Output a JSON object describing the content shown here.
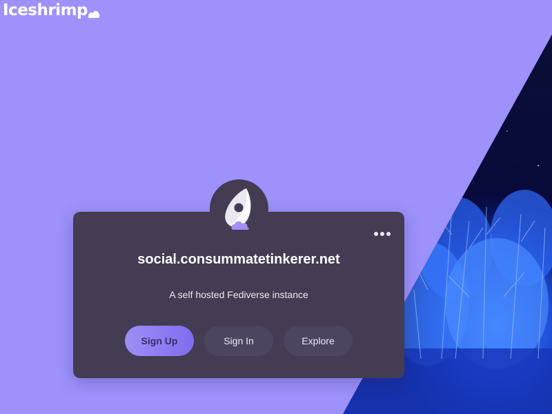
{
  "brand": {
    "name": "Iceshrimp",
    "icon": "cloud-icon"
  },
  "instance": {
    "name": "social.consummatetinkerer.net",
    "description": "A self hosted Fediverse instance",
    "avatar_icon": "iceshrimp-logo-icon"
  },
  "menu": {
    "icon": "more-dots-icon"
  },
  "actions": {
    "signup_label": "Sign Up",
    "signin_label": "Sign In",
    "explore_label": "Explore"
  },
  "colors": {
    "background": "#9d91fc",
    "card": "#433c52",
    "accent": "#8b7cf6",
    "brand_accent": "#a78bfa"
  }
}
